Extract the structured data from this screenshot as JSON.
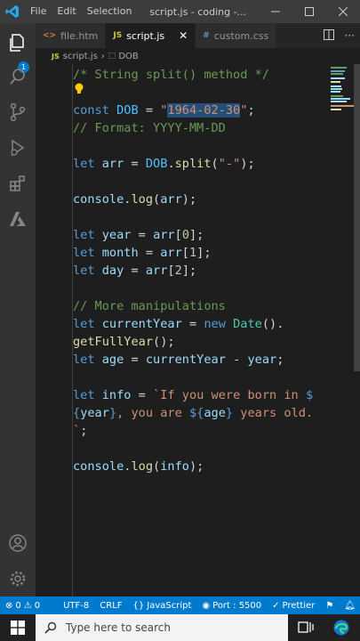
{
  "titlebar": {
    "menu": [
      "File",
      "Edit",
      "Selection"
    ],
    "title": "script.js - coding -..."
  },
  "tabs": [
    {
      "label": "file.htm",
      "icon": "<>",
      "icon_color": "#e37933",
      "active": false
    },
    {
      "label": "script.js",
      "icon": "JS",
      "icon_color": "#cbcb41",
      "active": true
    },
    {
      "label": "custom.css",
      "icon": "#",
      "icon_color": "#519aba",
      "active": false
    }
  ],
  "breadcrumb": {
    "file": "script.js",
    "symbol": "DOB",
    "file_icon": "JS"
  },
  "editor": {
    "lines": [
      "/* String split() method */",
      "const DOB = \"1964-02-30\";",
      "// Format: YYYY-MM-DD",
      "let arr = DOB.split(\"-\");",
      "console.log(arr);",
      "let year = arr[0];",
      "let month = arr[1];",
      "let day = arr[2];",
      "// More manipulations",
      "let currentYear = new Date().",
      "getFullYear();",
      "let age = currentYear - year;",
      "let info = `If you were born in $",
      "{year}, you are ${age} years old.",
      "`;",
      "console.log(info);"
    ]
  },
  "statusbar": {
    "errors": "0",
    "warnings": "0",
    "encoding": "UTF-8",
    "eol": "CRLF",
    "language": "JavaScript",
    "port": "Port : 5500",
    "formatter": "Prettier"
  },
  "taskbar": {
    "search_placeholder": "Type here to search"
  },
  "colors": {
    "accent": "#007acc",
    "keyword": "#569cd6",
    "string": "#ce9178",
    "comment": "#6a9955"
  }
}
